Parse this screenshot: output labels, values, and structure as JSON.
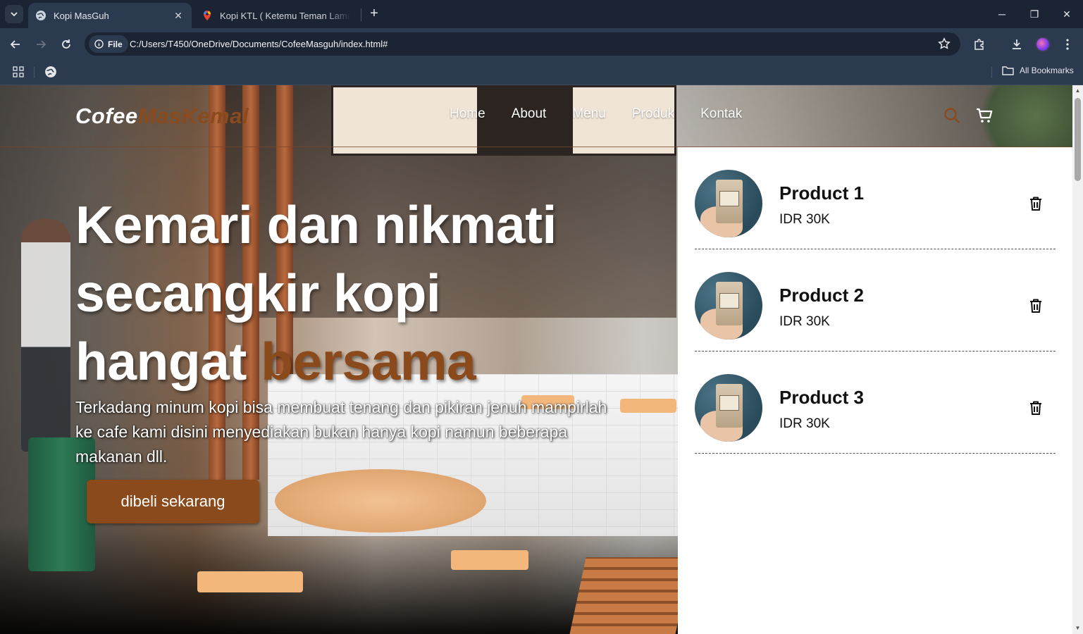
{
  "browser": {
    "tabs": [
      {
        "title": "Kopi MasGuh",
        "active": true
      },
      {
        "title": "Kopi KTL ( Ketemu Teman Lama",
        "active": false
      }
    ],
    "url_chip": "File",
    "url": "C:/Users/T450/OneDrive/Documents/CofeeMasguh/index.html#",
    "bookmarks_label": "All Bookmarks"
  },
  "site": {
    "logo_part1": "Cofee",
    "logo_part2": "MasKemal",
    "nav": [
      "Home",
      "About",
      "Menu",
      "Produk",
      "Kontak"
    ],
    "hero": {
      "title_line1": "Kemari dan nikmati",
      "title_line2": "secangkir kopi",
      "title_line3": "hangat",
      "title_accent": "bersama",
      "text": "Terkadang minum kopi bisa membuat tenang dan pikiran jenuh mampirlah ke cafe kami disini menyediakan bukan hanya kopi namun beberapa makanan dll.",
      "cta_label": "dibeli sekarang"
    },
    "cart": {
      "items": [
        {
          "name": "Product 1",
          "price": "IDR 30K"
        },
        {
          "name": "Product 2",
          "price": "IDR 30K"
        },
        {
          "name": "Product 3",
          "price": "IDR 30K"
        }
      ]
    },
    "colors": {
      "accent": "#8b4a1b",
      "cart_bg": "#ffffff"
    }
  }
}
